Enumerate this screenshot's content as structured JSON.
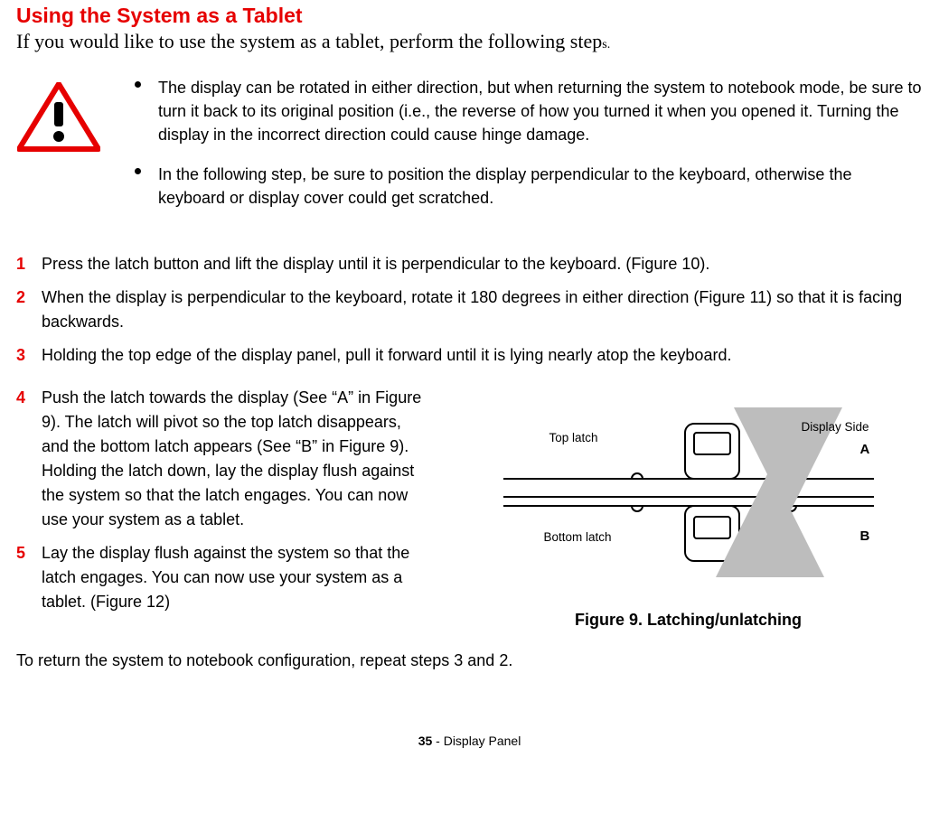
{
  "heading": "Using the System as a Tablet",
  "intro_line_prefix": "If you would like to use the system as a tablet, perform the following step",
  "intro_line_suffix": "s.",
  "caution_bullets": [
    "The display can be rotated in either direction, but when returning the system to notebook mode, be sure to turn it back to its original position (i.e., the reverse of how you turned it when you opened it. Turning the display in the incorrect direction could cause hinge damage.",
    "In the following step, be sure to position the display perpendicular to the keyboard, otherwise the keyboard or display cover could get scratched."
  ],
  "steps_main": [
    {
      "num": "1",
      "text": "Press the latch button and lift the display until it is perpendicular to the keyboard. (Figure 10)."
    },
    {
      "num": "2",
      "text": "When the display is perpendicular to the keyboard, rotate it 180 degrees in either direction (Figure 11) so that it is facing backwards."
    },
    {
      "num": "3",
      "text": "Holding the top edge of the display panel, pull it forward until it is lying nearly atop the keyboard."
    }
  ],
  "steps_side": [
    {
      "num": "4",
      "text": "Push the latch towards the display (See “A” in Figure 9). The latch will pivot so the top latch disappears, and the bottom latch appears (See “B” in Figure 9). Holding the latch down, lay the display flush against the system so that the latch engages. You can now use your system as a tablet."
    },
    {
      "num": "5",
      "text": "Lay the display flush against the system so that the latch engages. You can now use your system as a tablet. (Figure 12)"
    }
  ],
  "figure_caption": "Figure 9.  Latching/unlatching",
  "return_text": "To return the system to notebook configuration, repeat steps 3 and 2.",
  "footer_page": "35",
  "footer_section": " - Display Panel",
  "diagram": {
    "top_latch": "Top latch",
    "bottom_latch": "Bottom latch",
    "display_side": "Display Side",
    "labelA": "A",
    "labelB": "B"
  }
}
